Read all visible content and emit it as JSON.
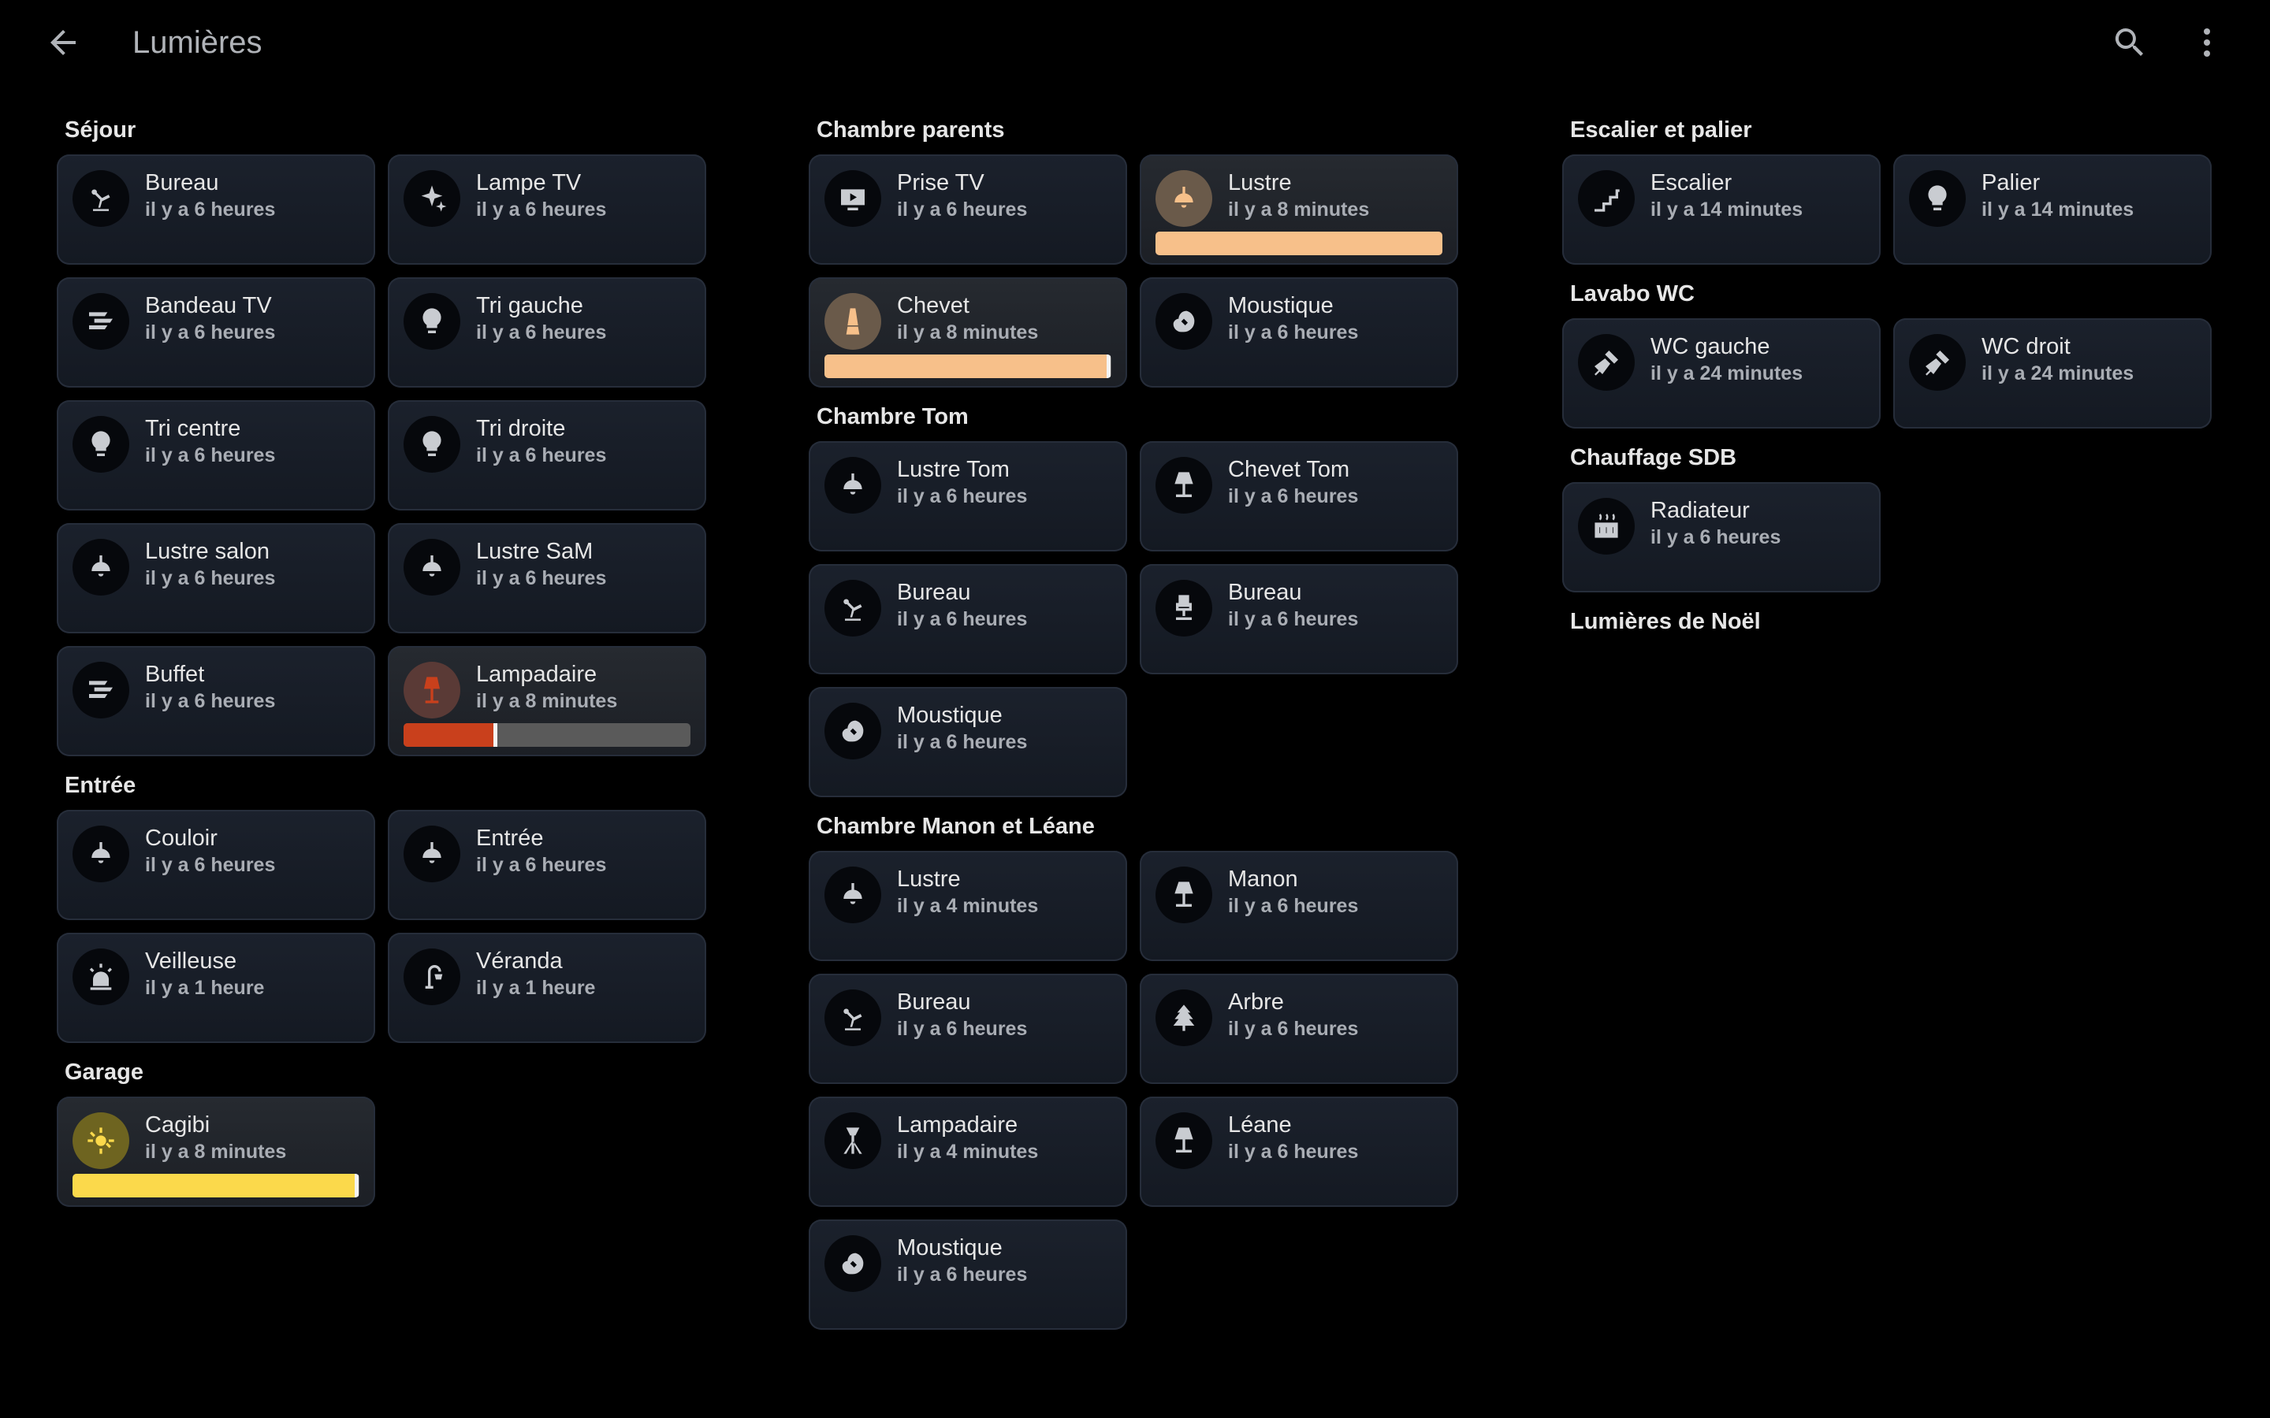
{
  "header": {
    "title": "Lumières",
    "back_icon": "arrow-left-icon",
    "search_icon": "search-icon",
    "menu_icon": "more-vertical-icon"
  },
  "colors": {
    "background": "#000000",
    "tile": "#1b212c",
    "lampadaire_on": "#c9401c",
    "lustre_on": "#f7c08a",
    "chevet_on": "#f7c08a",
    "cagibi_on": "#fbd94b"
  },
  "columns": [
    {
      "areas": [
        {
          "name": "Séjour",
          "tiles": [
            {
              "name": "Bureau",
              "time": "il y a 6 heures",
              "icon": "desk-lamp-icon"
            },
            {
              "name": "Lampe TV",
              "time": "il y a 6 heures",
              "icon": "sparkles-icon"
            },
            {
              "name": "Bandeau TV",
              "time": "il y a 6 heures",
              "icon": "led-strip-icon"
            },
            {
              "name": "Tri gauche",
              "time": "il y a 6 heures",
              "icon": "bulb-icon"
            },
            {
              "name": "Tri centre",
              "time": "il y a 6 heures",
              "icon": "bulb-icon"
            },
            {
              "name": "Tri droite",
              "time": "il y a 6 heures",
              "icon": "bulb-icon"
            },
            {
              "name": "Lustre salon",
              "time": "il y a 6 heures",
              "icon": "ceiling-light-icon"
            },
            {
              "name": "Lustre SaM",
              "time": "il y a 6 heures",
              "icon": "ceiling-light-icon"
            },
            {
              "name": "Buffet",
              "time": "il y a 6 heures",
              "icon": "led-strip-icon"
            },
            {
              "name": "Lampadaire",
              "time": "il y a 8 minutes",
              "icon": "floor-lamp-icon",
              "on": true,
              "color": "#c9401c",
              "brightness": 0.32
            }
          ]
        },
        {
          "name": "Entrée",
          "tiles": [
            {
              "name": "Couloir",
              "time": "il y a 6 heures",
              "icon": "ceiling-light-icon"
            },
            {
              "name": "Entrée",
              "time": "il y a 6 heures",
              "icon": "ceiling-light-icon"
            },
            {
              "name": "Veilleuse",
              "time": "il y a 1 heure",
              "icon": "alarm-light-icon"
            },
            {
              "name": "Véranda",
              "time": "il y a 1 heure",
              "icon": "outdoor-lamp-icon"
            }
          ]
        },
        {
          "name": "Garage",
          "tiles": [
            {
              "name": "Cagibi",
              "time": "il y a 8 minutes",
              "icon": "spotlight-icon",
              "on": true,
              "color": "#fbd94b",
              "brightness": 0.99
            }
          ]
        }
      ]
    },
    {
      "areas": [
        {
          "name": "Chambre parents",
          "tiles": [
            {
              "name": "Prise TV",
              "time": "il y a 6 heures",
              "icon": "tv-icon"
            },
            {
              "name": "Lustre",
              "time": "il y a 8 minutes",
              "icon": "ceiling-light-icon",
              "on": true,
              "color": "#f7c08a",
              "brightness": 1.0
            },
            {
              "name": "Chevet",
              "time": "il y a 8 minutes",
              "icon": "lava-lamp-icon",
              "on": true,
              "color": "#f7c08a",
              "brightness": 0.99
            },
            {
              "name": "Moustique",
              "time": "il y a 6 heures",
              "icon": "mosquito-icon"
            }
          ]
        },
        {
          "name": "Chambre Tom",
          "tiles": [
            {
              "name": "Lustre Tom",
              "time": "il y a 6 heures",
              "icon": "ceiling-light-icon"
            },
            {
              "name": "Chevet Tom",
              "time": "il y a 6 heures",
              "icon": "table-lamp-icon"
            },
            {
              "name": "Bureau",
              "time": "il y a 6 heures",
              "icon": "desk-lamp-icon"
            },
            {
              "name": "Bureau",
              "time": "il y a 6 heures",
              "icon": "office-chair-icon"
            },
            {
              "name": "Moustique",
              "time": "il y a 6 heures",
              "icon": "mosquito-icon"
            }
          ]
        },
        {
          "name": "Chambre Manon et Léane",
          "tiles": [
            {
              "name": "Lustre",
              "time": "il y a 4 minutes",
              "icon": "ceiling-light-icon"
            },
            {
              "name": "Manon",
              "time": "il y a 6 heures",
              "icon": "table-lamp-icon"
            },
            {
              "name": "Bureau",
              "time": "il y a 6 heures",
              "icon": "desk-lamp-icon"
            },
            {
              "name": "Arbre",
              "time": "il y a 6 heures",
              "icon": "pine-tree-icon"
            },
            {
              "name": "Lampadaire",
              "time": "il y a 4 minutes",
              "icon": "tripod-lamp-icon"
            },
            {
              "name": "Léane",
              "time": "il y a 6 heures",
              "icon": "table-lamp-icon"
            },
            {
              "name": "Moustique",
              "time": "il y a 6 heures",
              "icon": "mosquito-icon"
            }
          ]
        }
      ]
    },
    {
      "areas": [
        {
          "name": "Escalier et palier",
          "tiles": [
            {
              "name": "Escalier",
              "time": "il y a 14 minutes",
              "icon": "stairs-icon"
            },
            {
              "name": "Palier",
              "time": "il y a 14 minutes",
              "icon": "bulb-icon"
            }
          ]
        },
        {
          "name": "Lavabo WC",
          "tiles": [
            {
              "name": "WC gauche",
              "time": "il y a 24 minutes",
              "icon": "spotlight-beam-icon"
            },
            {
              "name": "WC droit",
              "time": "il y a 24 minutes",
              "icon": "spotlight-beam-icon"
            }
          ]
        },
        {
          "name": "Chauffage SDB",
          "tiles": [
            {
              "name": "Radiateur",
              "time": "il y a 6 heures",
              "icon": "radiator-icon"
            }
          ]
        },
        {
          "name": "Lumières de Noël",
          "tiles": []
        }
      ]
    }
  ]
}
